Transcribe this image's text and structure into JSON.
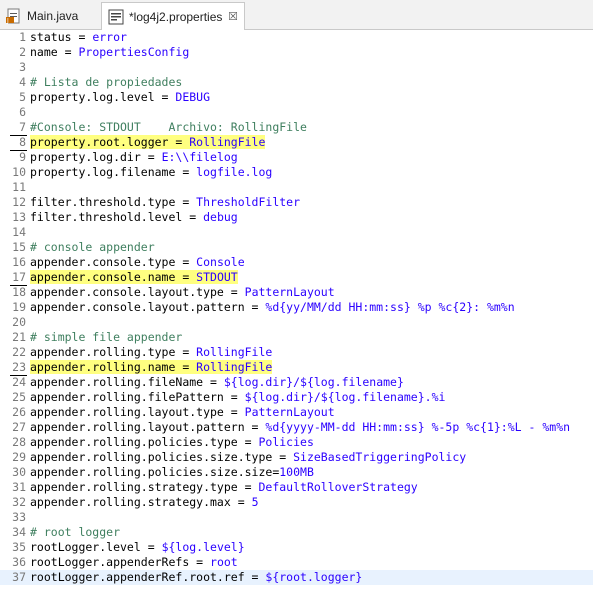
{
  "tabs": [
    {
      "label": "Main.java",
      "icon": "java-file-icon",
      "active": false
    },
    {
      "label": "*log4j2.properties",
      "icon": "properties-file-icon",
      "active": true,
      "close": "☒"
    }
  ],
  "lines": [
    {
      "n": "1",
      "k": "status = ",
      "v": "error"
    },
    {
      "n": "2",
      "k": "name = ",
      "v": "PropertiesConfig"
    },
    {
      "n": "3",
      "k": "",
      "v": ""
    },
    {
      "n": "4",
      "c": "# Lista de propiedades"
    },
    {
      "n": "5",
      "k": "property.log.level = ",
      "v": "DEBUG"
    },
    {
      "n": "6",
      "k": "",
      "v": ""
    },
    {
      "n": "7",
      "c": "#Console: STDOUT    Archivo: RollingFile"
    },
    {
      "n": "8",
      "k": "property.root.logger = ",
      "v": "RollingFile",
      "hl": true
    },
    {
      "n": "9",
      "k": "property.log.dir = ",
      "v": "E:\\\\filelog"
    },
    {
      "n": "10",
      "k": "property.log.filename = ",
      "v": "logfile.log"
    },
    {
      "n": "11",
      "k": "",
      "v": ""
    },
    {
      "n": "12",
      "k": "filter.threshold.type = ",
      "v": "ThresholdFilter"
    },
    {
      "n": "13",
      "k": "filter.threshold.level = ",
      "v": "debug"
    },
    {
      "n": "14",
      "k": "",
      "v": ""
    },
    {
      "n": "15",
      "c": "# console appender"
    },
    {
      "n": "16",
      "k": "appender.console.type = ",
      "v": "Console"
    },
    {
      "n": "17",
      "k": "appender.console.name = ",
      "v": "STDOUT",
      "hl": true
    },
    {
      "n": "18",
      "k": "appender.console.layout.type = ",
      "v": "PatternLayout"
    },
    {
      "n": "19",
      "k": "appender.console.layout.pattern = ",
      "v": "%d{yy/MM/dd HH:mm:ss} %p %c{2}: %m%n"
    },
    {
      "n": "20",
      "k": "",
      "v": ""
    },
    {
      "n": "21",
      "c": "# simple file appender"
    },
    {
      "n": "22",
      "k": "appender.rolling.type = ",
      "v": "RollingFile"
    },
    {
      "n": "23",
      "k": "appender.rolling.name = ",
      "v": "RollingFile",
      "hl": true
    },
    {
      "n": "24",
      "k": "appender.rolling.fileName = ",
      "v": "${log.dir}/${log.filename}"
    },
    {
      "n": "25",
      "k": "appender.rolling.filePattern = ",
      "v": "${log.dir}/${log.filename}.%i"
    },
    {
      "n": "26",
      "k": "appender.rolling.layout.type = ",
      "v": "PatternLayout"
    },
    {
      "n": "27",
      "k": "appender.rolling.layout.pattern = ",
      "v": "%d{yyyy-MM-dd HH:mm:ss} %-5p %c{1}:%L - %m%n"
    },
    {
      "n": "28",
      "k": "appender.rolling.policies.type = ",
      "v": "Policies"
    },
    {
      "n": "29",
      "k": "appender.rolling.policies.size.type = ",
      "v": "SizeBasedTriggeringPolicy"
    },
    {
      "n": "30",
      "k": "appender.rolling.policies.size.size=",
      "v": "100MB"
    },
    {
      "n": "31",
      "k": "appender.rolling.strategy.type = ",
      "v": "DefaultRolloverStrategy"
    },
    {
      "n": "32",
      "k": "appender.rolling.strategy.max = ",
      "v": "5"
    },
    {
      "n": "33",
      "k": "",
      "v": ""
    },
    {
      "n": "34",
      "c": "# root logger"
    },
    {
      "n": "35",
      "k": "rootLogger.level = ",
      "v": "${log.level}"
    },
    {
      "n": "36",
      "k": "rootLogger.appenderRefs = ",
      "v": "root"
    },
    {
      "n": "37",
      "k": "rootLogger.appenderRef.root.ref = ",
      "v": "${root.logger}",
      "cur": true
    }
  ],
  "marked_lines": [
    "7",
    "8",
    "17",
    "23"
  ],
  "colors": {
    "key": "#000000",
    "value": "#2a00ff",
    "comment": "#3f7f5f",
    "highlight": "#ffff80",
    "current_line": "#e8f2fe"
  }
}
